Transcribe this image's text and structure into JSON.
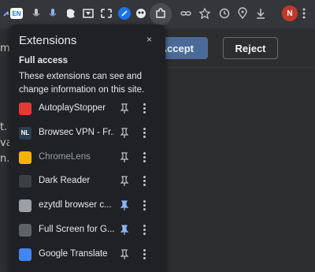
{
  "toolbar": {
    "lang_badge": "EN",
    "avatar_letter": "N",
    "icons": [
      "back-arrow-icon",
      "translate-icon",
      "mic-icon",
      "mic-icon",
      "extension-icon",
      "extension-icon",
      "extension-icon",
      "extension-icon",
      "extension-icon",
      "extensions-puzzle-icon",
      "link-icon",
      "star-icon",
      "history-icon",
      "location-icon",
      "download-icon",
      "profile-avatar",
      "chrome-menu-icon"
    ]
  },
  "page": {
    "accept_label": "Accept",
    "reject_label": "Reject",
    "fragments": [
      "m",
      "t. I",
      "va",
      "n."
    ]
  },
  "popup": {
    "title": "Extensions",
    "close": "×",
    "section_title": "Full access",
    "section_desc": "These extensions can see and change information on this site.",
    "extensions": [
      {
        "name": "AutoplayStopper",
        "pinned": false,
        "dim": false,
        "icon_color": "#e53935"
      },
      {
        "name": "Browsec VPN - Fr...",
        "pinned": false,
        "dim": false,
        "icon_color": "#2c3e50",
        "icon_text": "NL"
      },
      {
        "name": "ChromeLens",
        "pinned": false,
        "dim": true,
        "icon_color": "#f4b400"
      },
      {
        "name": "Dark Reader",
        "pinned": false,
        "dim": false,
        "icon_color": "#3c4043"
      },
      {
        "name": "ezytdl browser c...",
        "pinned": true,
        "dim": false,
        "icon_color": "#9aa0a6"
      },
      {
        "name": "Full Screen for G...",
        "pinned": true,
        "dim": false,
        "icon_color": "#5f6368"
      },
      {
        "name": "Google Translate",
        "pinned": false,
        "dim": false,
        "icon_color": "#4285f4"
      }
    ]
  },
  "colors": {
    "accent": "#4a6b97",
    "pin_active": "#8ab4f8",
    "pin_inactive": "#c4c7c5"
  }
}
